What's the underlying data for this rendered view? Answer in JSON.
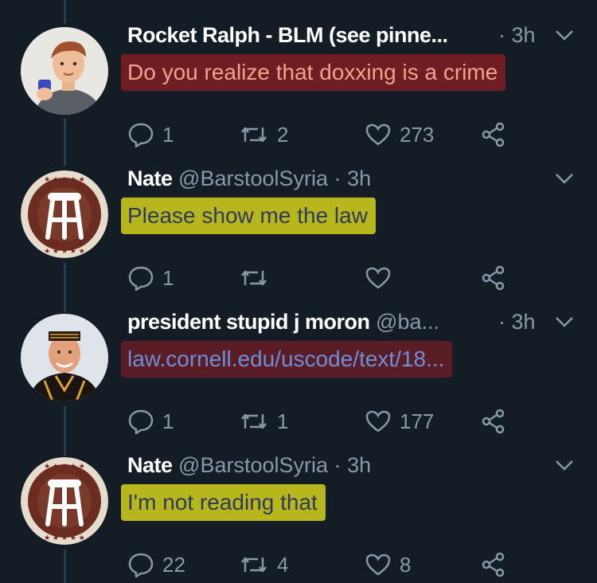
{
  "tweets": [
    {
      "name": "Rocket Ralph - BLM (see pinne...",
      "handle": "",
      "dot": "·",
      "time": "3h",
      "text": "Do you realize that doxxing is a crime",
      "replies": "1",
      "retweets": "2",
      "likes": "273",
      "highlight": "red",
      "avatar": "cartoon-man-avatar"
    },
    {
      "name": "Nate",
      "handle": "@BarstoolSyria",
      "dot": "·",
      "time": "3h",
      "text": "Please show me the law",
      "replies": "1",
      "retweets": "",
      "likes": "",
      "highlight": "yellow",
      "avatar": "barstool-stool-avatar"
    },
    {
      "name": "president stupid j moron",
      "handle": "@ba...",
      "dot": "·",
      "time": "3h",
      "text": "law.cornell.edu/uscode/text/18...",
      "replies": "1",
      "retweets": "1",
      "likes": "177",
      "highlight": "red-link",
      "avatar": "man-in-dashiki-avatar"
    },
    {
      "name": "Nate",
      "handle": "@BarstoolSyria",
      "dot": "·",
      "time": "3h",
      "text": "I'm not reading that",
      "replies": "22",
      "retweets": "4",
      "likes": "8",
      "highlight": "yellow",
      "avatar": "barstool-stool-avatar"
    }
  ],
  "colors": {
    "background": "#141d26",
    "secondary_text": "#8899a6",
    "red_highlight": "#6f1d22",
    "yellow_highlight": "#b7b61c",
    "link": "#6c8fd8"
  },
  "icons": {
    "reply": "reply-bubble-icon",
    "retweet": "retweet-icon",
    "like": "heart-icon",
    "share": "share-icon",
    "menu": "chevron-down-icon"
  }
}
